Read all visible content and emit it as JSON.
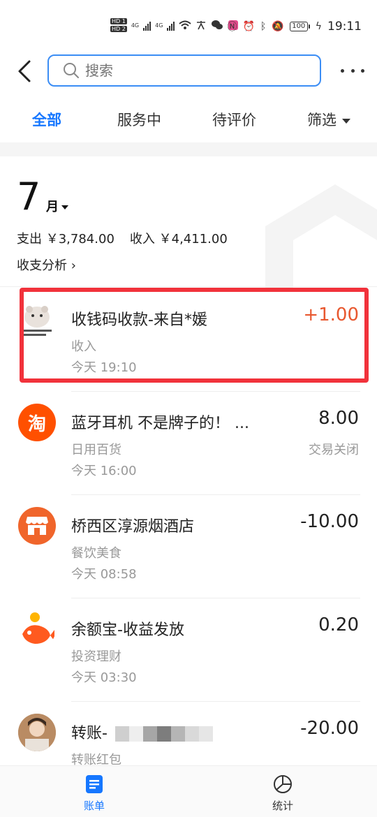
{
  "status_bar": {
    "hd1": "HD 1",
    "hd2": "HD 2",
    "net1": "4G",
    "net2": "4G",
    "battery": "100",
    "time": "19:11"
  },
  "header": {
    "search_placeholder": "搜索"
  },
  "tabs": [
    {
      "label": "全部",
      "active": true
    },
    {
      "label": "服务中",
      "active": false
    },
    {
      "label": "待评价",
      "active": false
    },
    {
      "label": "筛选",
      "active": false
    }
  ],
  "month": {
    "number": "7",
    "unit": "月",
    "expense_label": "支出",
    "expense_value": "￥3,784.00",
    "income_label": "收入",
    "income_value": "￥4,411.00",
    "analysis_link": "收支分析 ›"
  },
  "transactions": [
    {
      "title": "收钱码收款-来自*媛",
      "category": "收入",
      "time": "今天  19:10",
      "amount": "+1.00",
      "status": "",
      "icon": "hamster-avatar-icon",
      "highlighted": true
    },
    {
      "title": "蓝牙耳机 不是牌子的！ ...",
      "category": "日用百货",
      "time": "今天  16:00",
      "amount": "8.00",
      "status": "交易关闭",
      "icon": "taobao-icon"
    },
    {
      "title": "桥西区淳源烟酒店",
      "category": "餐饮美食",
      "time": "今天  08:58",
      "amount": "-10.00",
      "status": "",
      "icon": "store-icon"
    },
    {
      "title": "余额宝-收益发放",
      "category": "投资理财",
      "time": "今天  03:30",
      "amount": "0.20",
      "status": "",
      "icon": "yuebao-fish-icon"
    },
    {
      "title": "转账-",
      "category": "转账红包",
      "time": "",
      "amount": "-20.00",
      "status": "",
      "icon": "user-avatar-icon"
    }
  ],
  "bottom_nav": {
    "bill_label": "账单",
    "stats_label": "统计"
  },
  "colors": {
    "accent": "#1677ff",
    "income": "#e8582f",
    "highlight": "#f1323b",
    "taobao": "#ff5000",
    "store": "#f0652b"
  }
}
